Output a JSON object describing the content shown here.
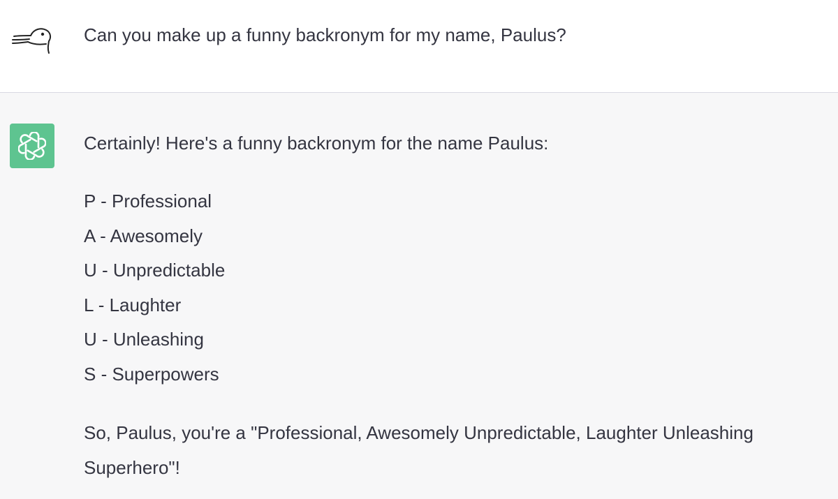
{
  "user": {
    "avatar_icon": "duck-sketch-icon",
    "message": "Can you make up a funny backronym for my name, Paulus?"
  },
  "assistant": {
    "avatar_icon": "openai-logo-icon",
    "avatar_color": "#5ec490",
    "intro": "Certainly! Here's a funny backronym for the name Paulus:",
    "items": [
      "P - Professional",
      "A - Awesomely",
      "U - Unpredictable",
      "L - Laughter",
      "U - Unleashing",
      "S - Superpowers"
    ],
    "outro": "So, Paulus, you're a \"Professional, Awesomely Unpredictable, Laughter Unleashing Superhero\"!"
  }
}
